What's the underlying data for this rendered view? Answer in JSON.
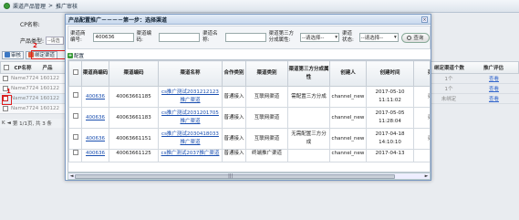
{
  "breadcrumb": {
    "root": "渠道产品管理",
    "sep": ">",
    "current": "推广审核"
  },
  "bg_filters": {
    "cp_label": "CP名称:",
    "product_type_label": "产品类型:",
    "product_type_value": "--请选"
  },
  "bg_toolbar": {
    "audit": "审核",
    "bind": "绑定渠道"
  },
  "markers": {
    "one": "1",
    "two": "2"
  },
  "bg_table": {
    "headers": [
      "CP名称",
      "产品"
    ],
    "rows": [
      [
        "Name7724",
        "160122"
      ],
      [
        "Name7724",
        "160122"
      ],
      [
        "Name7724",
        "160122"
      ],
      [
        "Name7724",
        "160122"
      ]
    ]
  },
  "bg_pager": {
    "first": "K",
    "prev": "◄",
    "text": "第 1/1页, 共 3 条"
  },
  "right_table": {
    "headers": [
      "绑定渠道个数",
      "推广评估"
    ],
    "rows": [
      [
        "1个",
        "查看"
      ],
      [
        "1个",
        "查看"
      ],
      [
        "未绑定",
        "查看"
      ]
    ]
  },
  "dialog": {
    "title": "产品配置推广－－－－第一步：选择渠道",
    "close": "×",
    "filters": {
      "channel_id_label": "渠道商编号:",
      "channel_id_value": "400636",
      "channel_code_label": "渠道编码:",
      "channel_name_label": "渠道名称:",
      "third_party_label": "渠道第三方分成属性:",
      "third_party_value": "--请选择--",
      "status_label": "渠道状态:",
      "status_value": "--请选择--",
      "search": "查询"
    },
    "config_label": "配置",
    "columns": [
      "",
      "渠道商编码",
      "渠道编码",
      "渠道名称",
      "合作类别",
      "渠道类别",
      "渠道第三方分成属性",
      "创建人",
      "创建时间",
      "渠道"
    ],
    "rows": [
      {
        "vendor": "400636",
        "code": "40063661185",
        "name": "cs推广测试2031212123推广渠道",
        "coop": "普通接入",
        "type": "互联网渠道",
        "attr": "需配置三方分成",
        "creator": "channel_new",
        "created": "2017-05-10 11:11:02",
        "extra": "渠道"
      },
      {
        "vendor": "400636",
        "code": "40063661183",
        "name": "cs推广测试2031201705推广渠道",
        "coop": "普通接入",
        "type": "互联网渠道",
        "attr": "",
        "creator": "channel_new",
        "created": "2017-05-05 11:28:04",
        "extra": "渠道"
      },
      {
        "vendor": "400636",
        "code": "40063661151",
        "name": "cs推广测试2030418033推广渠道",
        "coop": "普通接入",
        "type": "互联网渠道",
        "attr": "无需配置三方分成",
        "creator": "channel_new",
        "created": "2017-04-18 14:10:10",
        "extra": "渠道"
      },
      {
        "vendor": "400636",
        "code": "40063661125",
        "name": "cs推广测试2037推广渠道",
        "coop": "普通接入",
        "type": "终端推广渠道",
        "attr": "",
        "creator": "channel_new",
        "created": "2017-04-13",
        "extra": ""
      }
    ],
    "scroll": {
      "left": "◄",
      "right": "►",
      "grip": "|||"
    }
  }
}
